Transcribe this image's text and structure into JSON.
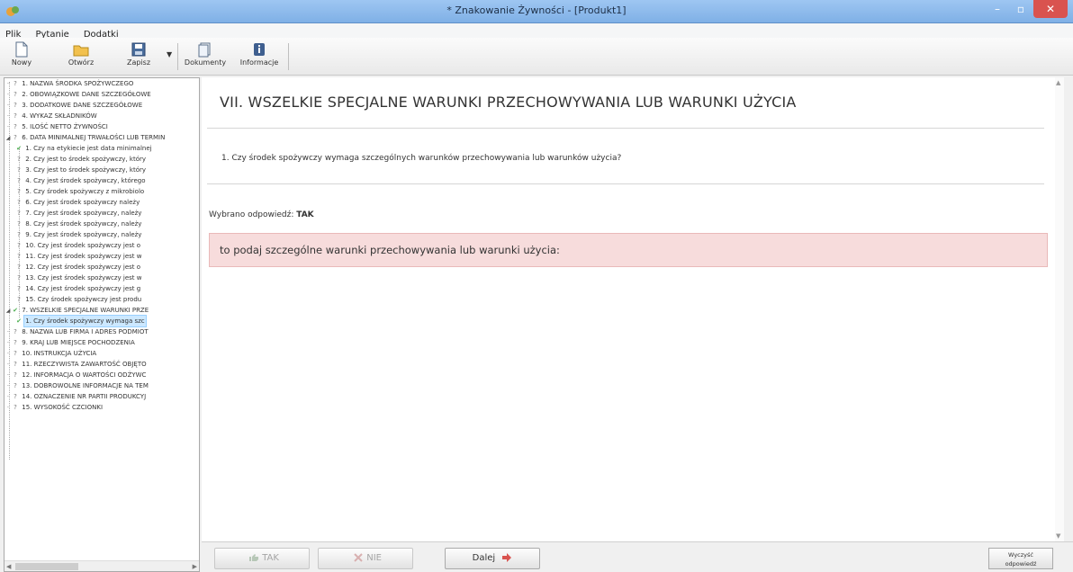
{
  "window": {
    "title": "* Znakowanie Żywności - [Produkt1]",
    "minimize_glyph": "–",
    "maximize_glyph": "▫",
    "close_glyph": "✕"
  },
  "menu": [
    {
      "label": "Plik"
    },
    {
      "label": "Pytanie"
    },
    {
      "label": "Dodatki"
    }
  ],
  "toolbar": {
    "new_label": "Nowy",
    "open_label": "Otwórz",
    "save_label": "Zapisz",
    "dropdown_glyph": "▼",
    "documents_label": "Dokumenty",
    "info_label": "Informacje"
  },
  "tree": {
    "items": [
      {
        "mark": "?",
        "label": "1. NAZWA ŚRODKA SPOŻYWCZEGO"
      },
      {
        "mark": "?",
        "label": "2. OBOWIĄZKOWE DANE SZCZEGÓŁOWE"
      },
      {
        "mark": "?",
        "label": "3. DODATKOWE DANE SZCZEGÓŁOWE"
      },
      {
        "mark": "?",
        "label": "4. WYKAZ SKŁADNIKÓW"
      },
      {
        "mark": "?",
        "label": "5. ILOŚĆ NETTO ŻYWNOŚCI"
      },
      {
        "mark": "?",
        "label": "6. DATA MINIMALNEJ TRWAŁOŚCI LUB TERMIN"
      },
      {
        "mark": "✔",
        "label": "1. Czy na etykiecie jest data minimalnej"
      },
      {
        "mark": "?",
        "label": "2. Czy jest to środek spożywczy, który"
      },
      {
        "mark": "?",
        "label": "3. Czy jest to środek spożywczy, który"
      },
      {
        "mark": "?",
        "label": "4. Czy jest środek spożywczy, którego"
      },
      {
        "mark": "?",
        "label": "5. Czy środek spożywczy z mikrobiolo"
      },
      {
        "mark": "?",
        "label": "6. Czy jest środek spożywczy należy"
      },
      {
        "mark": "?",
        "label": "7. Czy jest środek spożywczy, należy"
      },
      {
        "mark": "?",
        "label": "8. Czy jest środek spożywczy, należy"
      },
      {
        "mark": "?",
        "label": "9. Czy jest środek spożywczy, należy"
      },
      {
        "mark": "?",
        "label": "10. Czy jest środek spożywczy jest o"
      },
      {
        "mark": "?",
        "label": "11. Czy jest środek spożywczy jest w"
      },
      {
        "mark": "?",
        "label": "12. Czy jest środek spożywczy jest o"
      },
      {
        "mark": "?",
        "label": "13. Czy jest środek spożywczy jest w"
      },
      {
        "mark": "?",
        "label": "14. Czy jest środek spożywczy jest g"
      },
      {
        "mark": "?",
        "label": "15. Czy środek spożywczy jest produ"
      },
      {
        "mark": "✔",
        "label": "7. WSZELKIE SPECJALNE WARUNKI PRZE"
      },
      {
        "mark": "✔",
        "label": "1. Czy środek spożywczy wymaga szc"
      },
      {
        "mark": "?",
        "label": "8. NAZWA LUB FIRMA I ADRES PODMIOT"
      },
      {
        "mark": "?",
        "label": "9. KRAJ LUB MIEJSCE POCHODZENIA"
      },
      {
        "mark": "?",
        "label": "10. INSTRUKCJA UŻYCIA"
      },
      {
        "mark": "?",
        "label": "11. RZECZYWISTA ZAWARTOŚĆ OBJĘTO"
      },
      {
        "mark": "?",
        "label": "12. INFORMACJA O WARTOŚCI ODŻYWC"
      },
      {
        "mark": "?",
        "label": "13. DOBROWOLNE INFORMACJE NA TEM"
      },
      {
        "mark": "?",
        "label": "14. OZNACZENIE NR PARTII PRODUKCYJ"
      },
      {
        "mark": "?",
        "label": "15. WYSOKOŚĆ CZCIONKI"
      }
    ]
  },
  "content": {
    "section_title": "VII. WSZELKIE SPECJALNE WARUNKI PRZECHOWYWANIA LUB WARUNKI UŻYCIA",
    "question": "1.  Czy środek spożywczy wymaga szczególnych warunków przechowywania lub warunków użycia?",
    "answer_prefix": "Wybrano odpowiedź:",
    "answer_value": "TAK",
    "alert_text": "to podaj szczególne warunki przechowywania lub warunki użycia:"
  },
  "bottom": {
    "yes_label": "TAK",
    "no_label": "NIE",
    "next_label": "Dalej",
    "clear_label_1": "Wyczyść",
    "clear_label_2": "odpowiedź"
  },
  "colors": {
    "alert_bg": "#f7dcdc",
    "check_green": "#4caf50",
    "next_arrow": "#d9534f"
  }
}
